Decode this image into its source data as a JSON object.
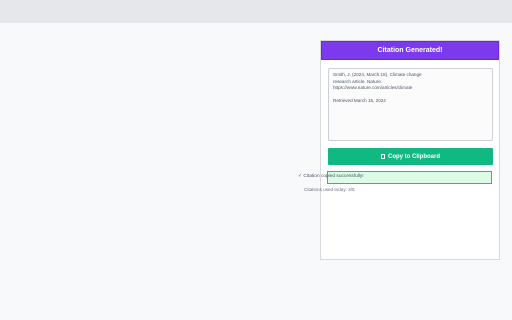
{
  "header": {
    "title": "Citation Generated!"
  },
  "citation": {
    "line1": "Smith, J. (2024, March 15). Climate change",
    "line2": "research article. Nature.",
    "line3": "https://www.nature.com/articles/climate",
    "retrieved": "Retrieved March 15, 2024"
  },
  "copy_button": {
    "icon": "clipboard-icon",
    "label": "Copy to Clipboard"
  },
  "status": {
    "message": "✓ Citation copied successfully!",
    "usage": "Citations used today: 3/5"
  },
  "colors": {
    "header_bg": "#7c3aed",
    "button_bg": "#10b981",
    "success_bg": "#dcfce7",
    "success_border": "#22c55e"
  }
}
